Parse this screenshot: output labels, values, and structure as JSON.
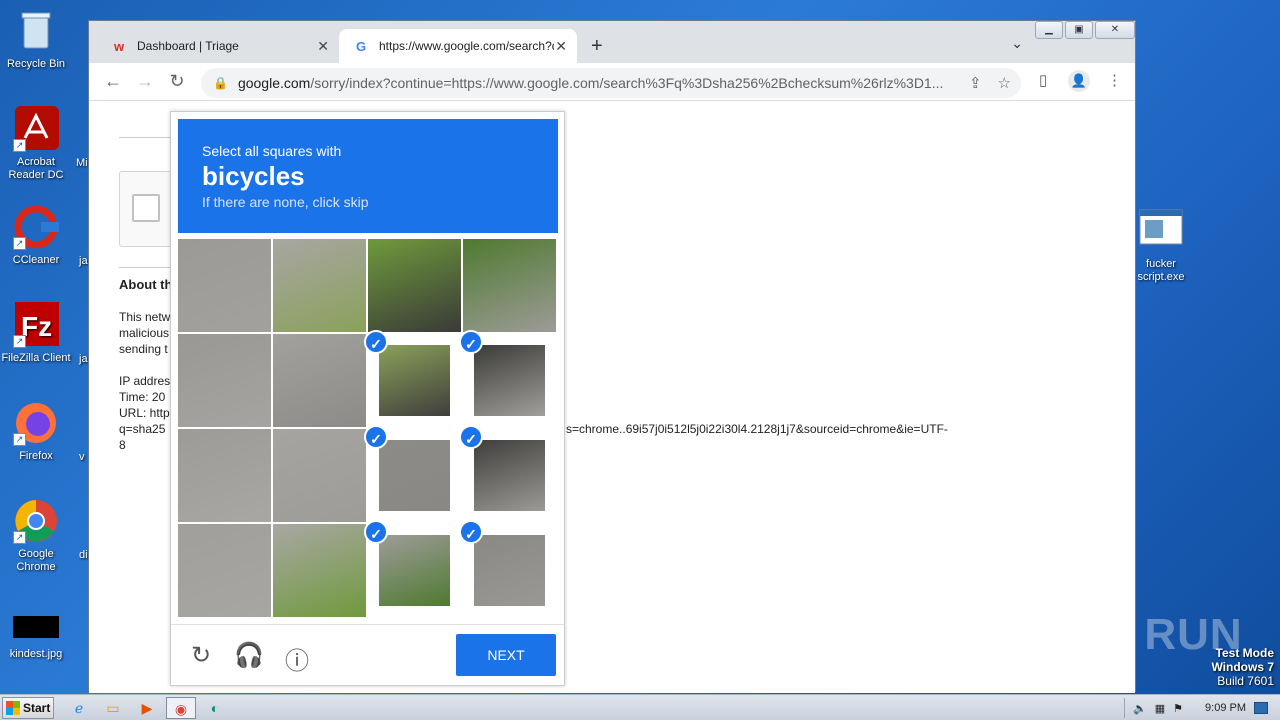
{
  "desktop": {
    "icons": [
      {
        "label": "Recycle Bin",
        "icon": "recycle-bin-icon"
      },
      {
        "label": "Acrobat Reader DC",
        "icon": "acrobat-icon"
      },
      {
        "label": "CCleaner",
        "icon": "ccleaner-icon"
      },
      {
        "label": "FileZilla Client",
        "icon": "filezilla-icon"
      },
      {
        "label": "Firefox",
        "icon": "firefox-icon"
      },
      {
        "label": "Google Chrome",
        "icon": "chrome-icon"
      },
      {
        "label": "kindest.jpg",
        "icon": "image-file-icon"
      },
      {
        "label": "fucker script.exe",
        "icon": "exe-file-icon"
      }
    ],
    "partial_labels": [
      "Mi",
      "ja",
      "ja",
      "v",
      "di"
    ]
  },
  "browser": {
    "tabs": [
      {
        "title": "Dashboard | Triage",
        "icon": "triage-icon"
      },
      {
        "title": "https://www.google.com/search?q=",
        "icon": "google-icon"
      }
    ],
    "new_tab": "+",
    "url_host": "google.com",
    "url_path": "/sorry/index?continue=https://www.google.com/search%3Fq%3Dsha256%2Bchecksum%26rlz%3D1..."
  },
  "page": {
    "about_heading": "About th",
    "body_lines": [
      "This netw",
      "malicious",
      "sending t"
    ],
    "ip_line": "IP addres",
    "time_line": "Time: 20",
    "url_line": "URL: http",
    "q_line": "q=sha25",
    "q_continued": "s=chrome..69i57j0i512l5j0i22i30l4.2128j1j7&sourceid=chrome&ie=UTF-",
    "wrap_tail": "8"
  },
  "captcha": {
    "instruction": "Select all squares with",
    "target": "bicycles",
    "hint": "If there are none, click skip",
    "next_label": "NEXT",
    "selected_tiles": [
      6,
      7,
      10,
      11,
      14,
      15
    ]
  },
  "taskbar": {
    "start_label": "Start",
    "clock": "9:09 PM"
  },
  "watermark": {
    "line1": "Test Mode",
    "line2": "Windows 7",
    "line3": "Build 7601",
    "brand": "ANY RUN"
  }
}
